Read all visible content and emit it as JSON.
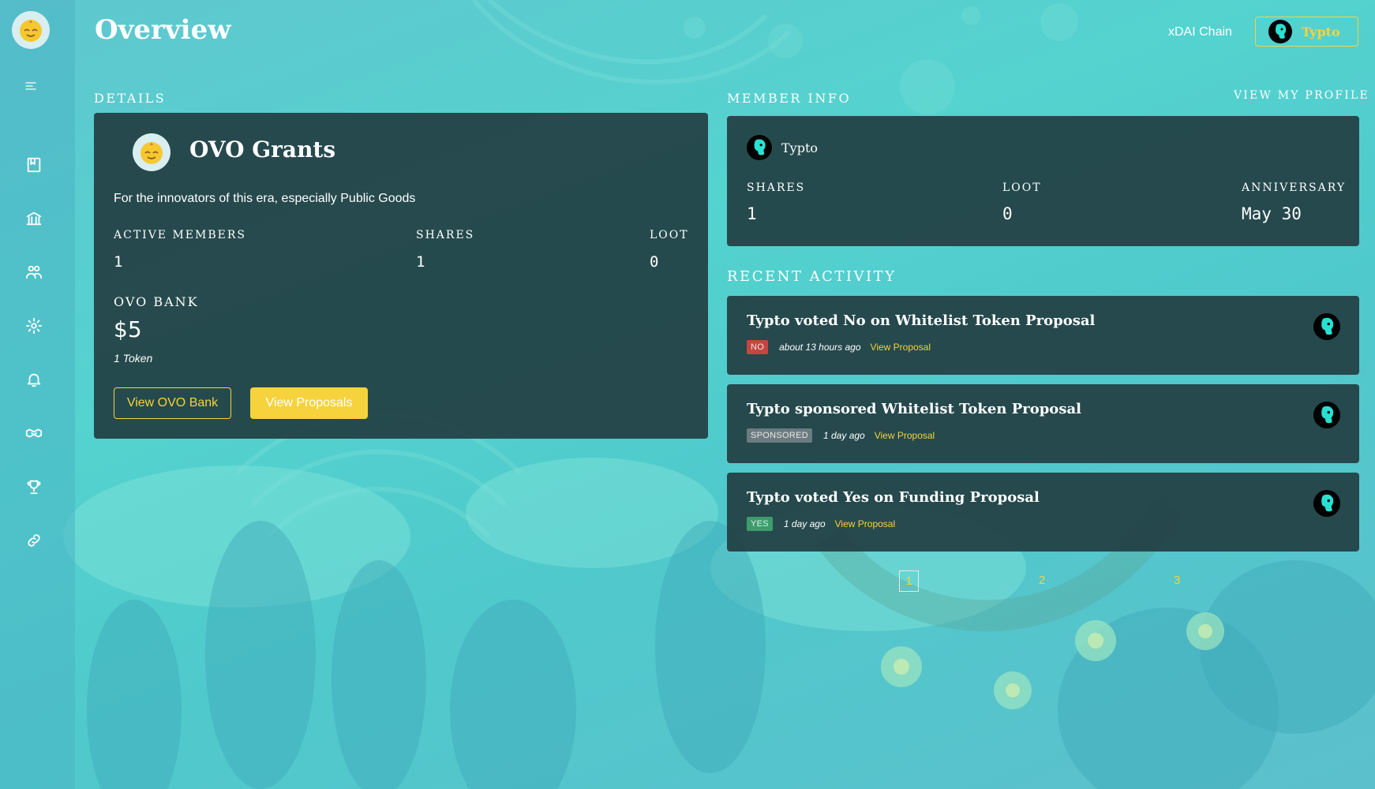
{
  "header": {
    "title": "Overview",
    "chain": "xDAI Chain",
    "user_button_label": "Typto"
  },
  "sidebar": {
    "items": [
      "menu-icon",
      "book-icon",
      "bank-icon",
      "members-icon",
      "gear-icon",
      "bell-icon",
      "handshake-icon",
      "trophy-icon",
      "link-icon"
    ]
  },
  "details": {
    "section_label": "DETAILS",
    "dao_name": "OVO Grants",
    "description": "For the innovators of this era, especially Public Goods",
    "active_members_label": "ACTIVE MEMBERS",
    "active_members_value": "1",
    "shares_label": "SHARES",
    "shares_value": "1",
    "loot_label": "LOOT",
    "loot_value": "0",
    "bank_label": "OVO BANK",
    "bank_value": "$5",
    "bank_tokens": "1 Token",
    "view_bank_label": "View OVO Bank",
    "view_proposals_label": "View Proposals"
  },
  "member_info": {
    "section_label": "MEMBER INFO",
    "view_profile_label": "VIEW MY PROFILE",
    "name": "Typto",
    "shares_label": "SHARES",
    "shares_value": "1",
    "loot_label": "LOOT",
    "loot_value": "0",
    "anniversary_label": "ANNIVERSARY",
    "anniversary_value": "May 30"
  },
  "recent_activity": {
    "section_label": "RECENT ACTIVITY",
    "items": [
      {
        "title": "Typto voted No on Whitelist Token Proposal",
        "badge": "NO",
        "time": "about 13 hours ago",
        "link": "View Proposal"
      },
      {
        "title": "Typto sponsored Whitelist Token Proposal",
        "badge": "SPONSORED",
        "time": "1 day ago",
        "link": "View Proposal"
      },
      {
        "title": "Typto voted Yes on Funding Proposal",
        "badge": "YES",
        "time": "1 day ago",
        "link": "View Proposal"
      }
    ]
  },
  "pagination": {
    "pages": [
      "1",
      "2",
      "3"
    ],
    "current": "1"
  },
  "colors": {
    "accent": "#f6d33c",
    "panel": "#223e42",
    "background": "#54d3cf",
    "badge_no": "#c5463f",
    "badge_sponsored": "#6b7b80",
    "badge_yes": "#3e9c6c"
  }
}
